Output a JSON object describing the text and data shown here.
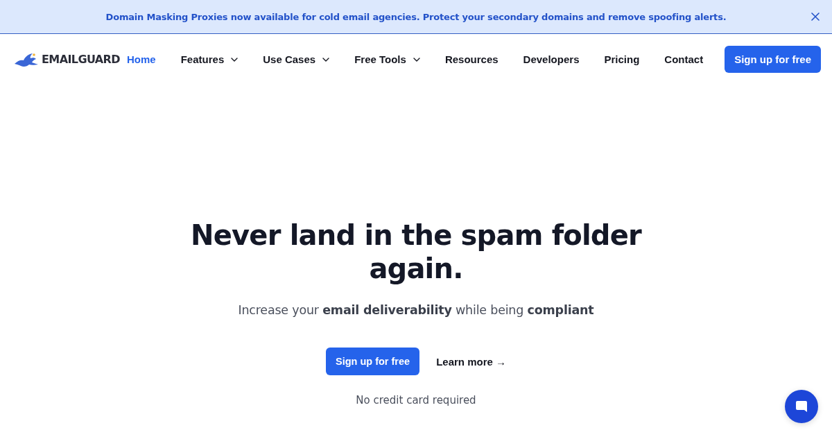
{
  "announcement": {
    "text": "Domain Masking Proxies now available for cold email agencies. Protect your secondary domains and remove spoofing alerts."
  },
  "header": {
    "logo": "EMAILGUARD",
    "nav": [
      {
        "label": "Home",
        "selected": true,
        "has_menu": false
      },
      {
        "label": "Features",
        "selected": false,
        "has_menu": true
      },
      {
        "label": "Use Cases",
        "selected": false,
        "has_menu": true
      },
      {
        "label": "Free Tools",
        "selected": false,
        "has_menu": true
      },
      {
        "label": "Resources",
        "selected": false,
        "has_menu": false
      },
      {
        "label": "Developers",
        "selected": false,
        "has_menu": false
      },
      {
        "label": "Pricing",
        "selected": false,
        "has_menu": false
      },
      {
        "label": "Contact",
        "selected": false,
        "has_menu": false
      }
    ],
    "cta": "Sign up for free"
  },
  "hero": {
    "title": "Never land in the spam folder again.",
    "subtitle": "Increase your **email deliverability** while being **compliant**",
    "primary_button": "Sign up for free",
    "secondary_link": "Learn more →",
    "note": "No credit card required"
  }
}
